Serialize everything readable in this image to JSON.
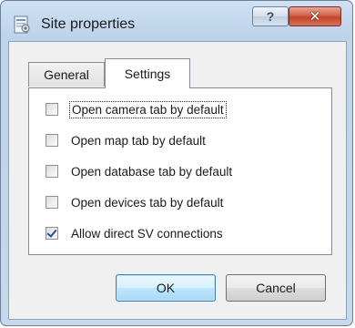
{
  "window": {
    "title": "Site properties",
    "help_label": "?",
    "close_label": "✕"
  },
  "tabs": [
    {
      "label": "General",
      "active": false
    },
    {
      "label": "Settings",
      "active": true
    }
  ],
  "settings": {
    "options": [
      {
        "label": "Open camera tab by default",
        "checked": false
      },
      {
        "label": "Open map tab by default",
        "checked": false
      },
      {
        "label": "Open database tab by default",
        "checked": false
      },
      {
        "label": "Open devices tab by default",
        "checked": false
      },
      {
        "label": "Allow direct SV connections",
        "checked": true
      }
    ]
  },
  "buttons": {
    "ok_label": "OK",
    "cancel_label": "Cancel"
  },
  "colors": {
    "title_bar": "#bcd3ea",
    "close_button": "#c2432b",
    "ok_button": "#bee6fd"
  }
}
